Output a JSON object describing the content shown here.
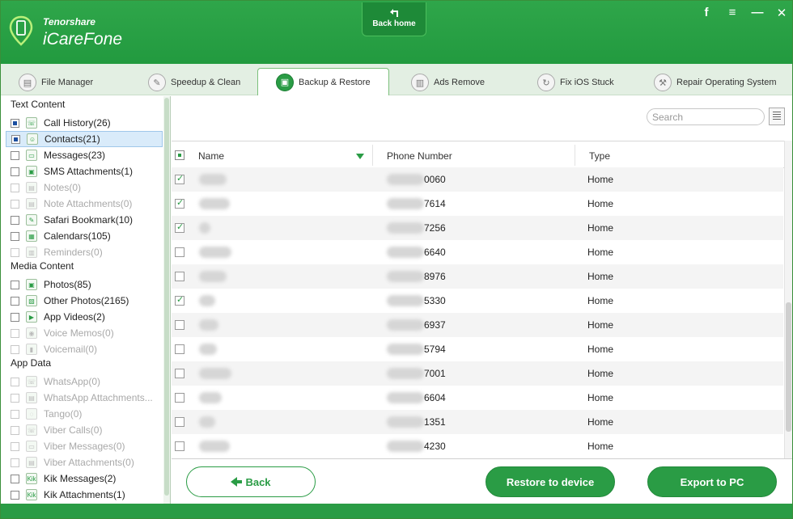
{
  "app": {
    "brand_top": "Tenorshare",
    "brand_main": "iCareFone",
    "back_home": "Back home",
    "controls": [
      "f",
      "≡",
      "—",
      "✕"
    ]
  },
  "tabs": [
    {
      "label": "File Manager",
      "icon": "file-manager-icon",
      "active": false
    },
    {
      "label": "Speedup & Clean",
      "icon": "speedup-icon",
      "active": false
    },
    {
      "label": "Backup & Restore",
      "icon": "backup-icon",
      "active": true
    },
    {
      "label": "Ads Remove",
      "icon": "ads-icon",
      "active": false
    },
    {
      "label": "Fix iOS Stuck",
      "icon": "fix-icon",
      "active": false
    },
    {
      "label": "Repair Operating System",
      "icon": "repair-icon",
      "active": false
    }
  ],
  "sidebar": {
    "sections": [
      {
        "title": "Text Content",
        "items": [
          {
            "label": "Call History(26)",
            "state": "filled",
            "disabled": false,
            "selected": false
          },
          {
            "label": "Contacts(21)",
            "state": "filled",
            "disabled": false,
            "selected": true
          },
          {
            "label": "Messages(23)",
            "state": "empty",
            "disabled": false,
            "selected": false
          },
          {
            "label": "SMS Attachments(1)",
            "state": "empty",
            "disabled": false,
            "selected": false
          },
          {
            "label": "Notes(0)",
            "state": "empty",
            "disabled": true,
            "selected": false
          },
          {
            "label": "Note Attachments(0)",
            "state": "empty",
            "disabled": true,
            "selected": false
          },
          {
            "label": "Safari Bookmark(10)",
            "state": "empty",
            "disabled": false,
            "selected": false
          },
          {
            "label": "Calendars(105)",
            "state": "empty",
            "disabled": false,
            "selected": false
          },
          {
            "label": "Reminders(0)",
            "state": "empty",
            "disabled": true,
            "selected": false
          }
        ]
      },
      {
        "title": "Media Content",
        "items": [
          {
            "label": "Photos(85)",
            "state": "empty",
            "disabled": false,
            "selected": false
          },
          {
            "label": "Other Photos(2165)",
            "state": "empty",
            "disabled": false,
            "selected": false
          },
          {
            "label": "App Videos(2)",
            "state": "empty",
            "disabled": false,
            "selected": false
          },
          {
            "label": "Voice Memos(0)",
            "state": "empty",
            "disabled": true,
            "selected": false
          },
          {
            "label": "Voicemail(0)",
            "state": "empty",
            "disabled": true,
            "selected": false
          }
        ]
      },
      {
        "title": "App Data",
        "items": [
          {
            "label": "WhatsApp(0)",
            "state": "empty",
            "disabled": true,
            "selected": false
          },
          {
            "label": "WhatsApp Attachments...",
            "state": "empty",
            "disabled": true,
            "selected": false
          },
          {
            "label": "Tango(0)",
            "state": "empty",
            "disabled": true,
            "selected": false
          },
          {
            "label": "Viber Calls(0)",
            "state": "empty",
            "disabled": true,
            "selected": false
          },
          {
            "label": "Viber Messages(0)",
            "state": "empty",
            "disabled": true,
            "selected": false
          },
          {
            "label": "Viber Attachments(0)",
            "state": "empty",
            "disabled": true,
            "selected": false
          },
          {
            "label": "Kik Messages(2)",
            "state": "empty",
            "disabled": false,
            "selected": false
          },
          {
            "label": "Kik Attachments(1)",
            "state": "empty",
            "disabled": false,
            "selected": false
          }
        ]
      }
    ]
  },
  "main": {
    "search_placeholder": "Search",
    "columns": [
      "Name",
      "Phone Number",
      "Type"
    ],
    "rows": [
      {
        "checked": true,
        "phone_suffix": "0060",
        "type": "Home"
      },
      {
        "checked": true,
        "phone_suffix": "7614",
        "type": "Home"
      },
      {
        "checked": true,
        "phone_suffix": "7256",
        "type": "Home"
      },
      {
        "checked": false,
        "phone_suffix": "6640",
        "type": "Home"
      },
      {
        "checked": false,
        "phone_suffix": "8976",
        "type": "Home"
      },
      {
        "checked": true,
        "phone_suffix": "5330",
        "type": "Home"
      },
      {
        "checked": false,
        "phone_suffix": "6937",
        "type": "Home"
      },
      {
        "checked": false,
        "phone_suffix": "5794",
        "type": "Home"
      },
      {
        "checked": false,
        "phone_suffix": "7001",
        "type": "Home"
      },
      {
        "checked": false,
        "phone_suffix": "6604",
        "type": "Home"
      },
      {
        "checked": false,
        "phone_suffix": "1351",
        "type": "Home"
      },
      {
        "checked": false,
        "phone_suffix": "4230",
        "type": "Home"
      }
    ]
  },
  "footer": {
    "back": "Back",
    "restore": "Restore to device",
    "export": "Export to PC"
  },
  "colors": {
    "accent": "#2a9c45",
    "header": "#229a3f"
  }
}
